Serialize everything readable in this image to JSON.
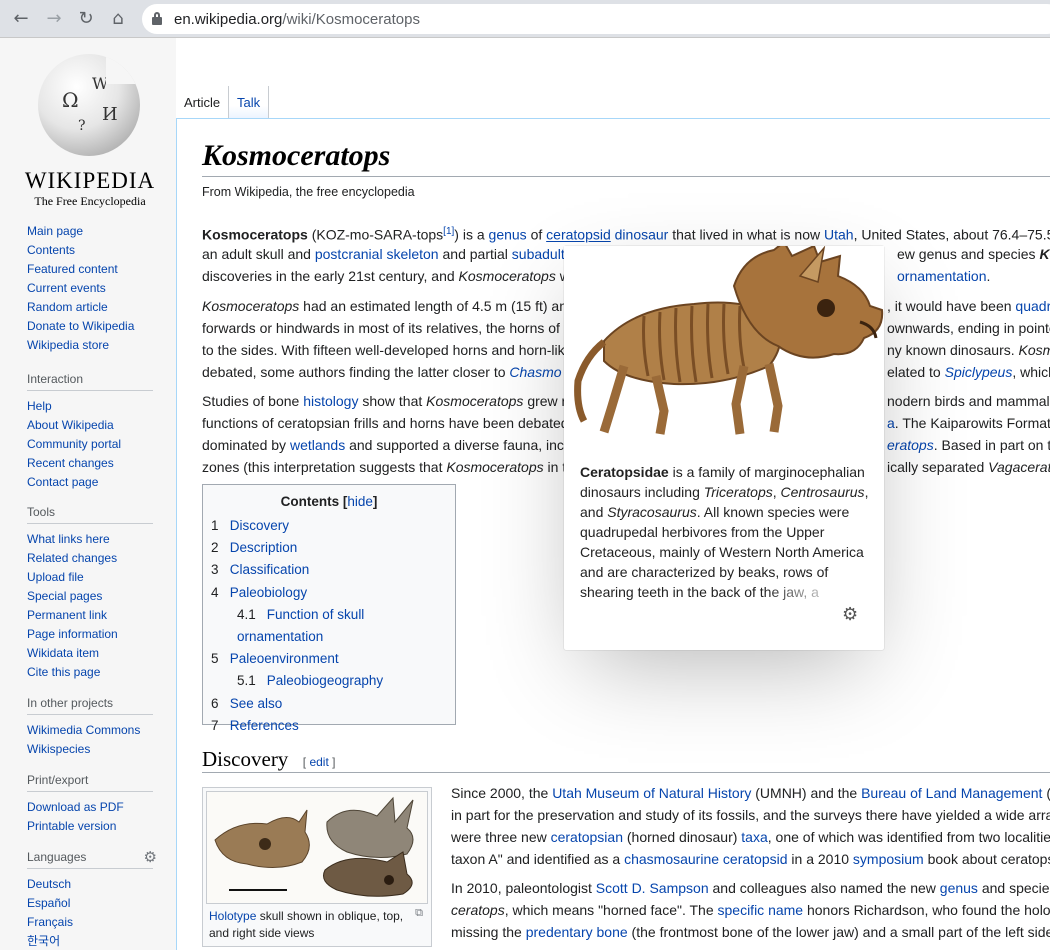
{
  "browser": {
    "url_domain": "en.wikipedia.org",
    "url_path": "/wiki/Kosmoceratops",
    "back_icon": "←",
    "forward_icon": "→",
    "reload_icon": "↻",
    "home_icon": "⌂"
  },
  "logo": {
    "wordmark": "WIKIPEDIA",
    "tagline": "The Free Encyclopedia",
    "globe_glyphs": [
      "Ω",
      "W",
      "И",
      "?"
    ]
  },
  "sidebar": {
    "navigation": [
      "Main page",
      "Contents",
      "Featured content",
      "Current events",
      "Random article",
      "Donate to Wikipedia",
      "Wikipedia store"
    ],
    "interaction": {
      "heading": "Interaction",
      "items": [
        "Help",
        "About Wikipedia",
        "Community portal",
        "Recent changes",
        "Contact page"
      ]
    },
    "tools": {
      "heading": "Tools",
      "items": [
        "What links here",
        "Related changes",
        "Upload file",
        "Special pages",
        "Permanent link",
        "Page information",
        "Wikidata item",
        "Cite this page"
      ]
    },
    "other_projects": {
      "heading": "In other projects",
      "items": [
        "Wikimedia Commons",
        "Wikispecies"
      ]
    },
    "print_export": {
      "heading": "Print/export",
      "items": [
        "Download as PDF",
        "Printable version"
      ]
    },
    "languages": {
      "heading": "Languages",
      "items": [
        "Deutsch",
        "Español",
        "Français",
        "한국어"
      ]
    }
  },
  "tabs": {
    "article": "Article",
    "talk": "Talk"
  },
  "article": {
    "title": "Kosmoceratops",
    "subtitle": "From Wikipedia, the free encyclopedia"
  },
  "toc": {
    "title": "Contents",
    "hide": "hide",
    "items": [
      {
        "num": "1",
        "label": "Discovery"
      },
      {
        "num": "2",
        "label": "Description"
      },
      {
        "num": "3",
        "label": "Classification"
      },
      {
        "num": "4",
        "label": "Paleobiology"
      },
      {
        "num": "4.1",
        "label": "Function of skull ornamentation"
      },
      {
        "num": "5",
        "label": "Paleoenvironment"
      },
      {
        "num": "5.1",
        "label": "Paleobiogeography"
      },
      {
        "num": "6",
        "label": "See also"
      },
      {
        "num": "7",
        "label": "References"
      }
    ]
  },
  "section": {
    "title": "Discovery",
    "edit": "edit"
  },
  "thumb": {
    "caption_link": "Holotype",
    "caption_rest": " skull shown in oblique, top, and right side views"
  },
  "popup": {
    "term": "Ceratopsidae",
    "t1": " is a family of marginocephalian dinosaurs including ",
    "i1": "Triceratops",
    "t2": ", ",
    "i2": "Centrosaurus",
    "t3": ", and ",
    "i3": "Styracosaurus",
    "t4": ". All known species were quadrupedal herbivores from the Upper Cretaceous, mainly of Western North America and are characterized by beaks, rows of shearing teeth in the back of the jaw, a"
  }
}
